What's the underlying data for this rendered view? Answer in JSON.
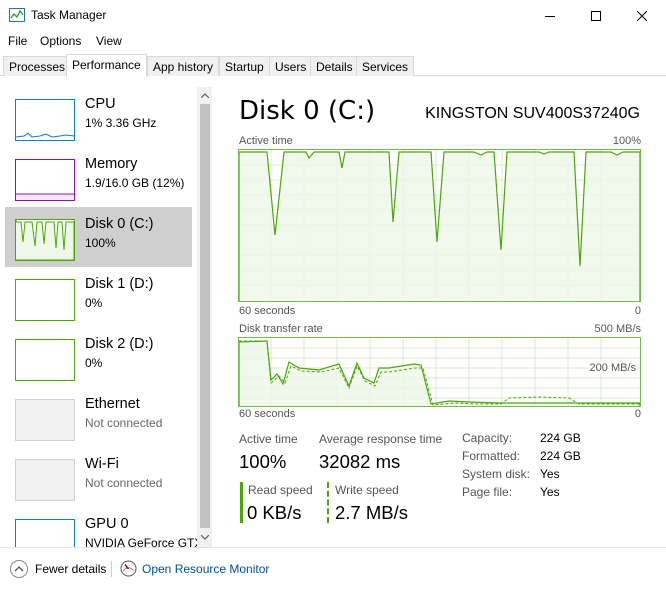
{
  "window": {
    "title": "Task Manager",
    "minimize_icon": "minimize-icon",
    "maximize_icon": "maximize-icon",
    "close_icon": "close-icon"
  },
  "menu": {
    "file": "File",
    "options": "Options",
    "view": "View"
  },
  "tabs": [
    {
      "label": "Processes"
    },
    {
      "label": "Performance",
      "active": true
    },
    {
      "label": "App history"
    },
    {
      "label": "Startup"
    },
    {
      "label": "Users"
    },
    {
      "label": "Details"
    },
    {
      "label": "Services"
    }
  ],
  "sidebar": {
    "items": [
      {
        "title": "CPU",
        "sub": "1% 3.36 GHz",
        "color": "#117dbb"
      },
      {
        "title": "Memory",
        "sub": "1.9/16.0 GB (12%)",
        "color": "#8b12ae"
      },
      {
        "title": "Disk 0 (C:)",
        "sub": "100%",
        "color": "#4da60c",
        "selected": true
      },
      {
        "title": "Disk 1 (D:)",
        "sub": "0%",
        "color": "#4da60c"
      },
      {
        "title": "Disk 2 (D:)",
        "sub": "0%",
        "color": "#4da60c"
      },
      {
        "title": "Ethernet",
        "sub": "Not connected",
        "color": "#a0a0a0"
      },
      {
        "title": "Wi-Fi",
        "sub": "Not connected",
        "color": "#a0a0a0"
      },
      {
        "title": "GPU 0",
        "sub": "NVIDIA GeForce GTX",
        "color": "#117dbb"
      }
    ]
  },
  "main": {
    "title": "Disk 0 (C:)",
    "model": "KINGSTON SUV400S37240G",
    "active_time_graph": {
      "label": "Active time",
      "max": "100%",
      "time_left": "60 seconds",
      "time_right": "0"
    },
    "transfer_graph": {
      "label": "Disk transfer rate",
      "max": "500 MB/s",
      "mid": "200 MB/s",
      "time_left": "60 seconds",
      "time_right": "0"
    },
    "stats": {
      "active_time_label": "Active time",
      "active_time_value": "100%",
      "response_label": "Average response time",
      "response_value": "32082 ms",
      "read_label": "Read speed",
      "read_value": "0 KB/s",
      "write_label": "Write speed",
      "write_value": "2.7 MB/s"
    },
    "props": [
      {
        "key": "Capacity:",
        "value": "224 GB"
      },
      {
        "key": "Formatted:",
        "value": "224 GB"
      },
      {
        "key": "System disk:",
        "value": "Yes"
      },
      {
        "key": "Page file:",
        "value": "Yes"
      }
    ]
  },
  "footer": {
    "fewer_details": "Fewer details",
    "open_monitor": "Open Resource Monitor"
  },
  "colors": {
    "disk_accent": "#4da60c",
    "disk_fill": "#eff7e9",
    "disk_border": "#74b94d"
  }
}
